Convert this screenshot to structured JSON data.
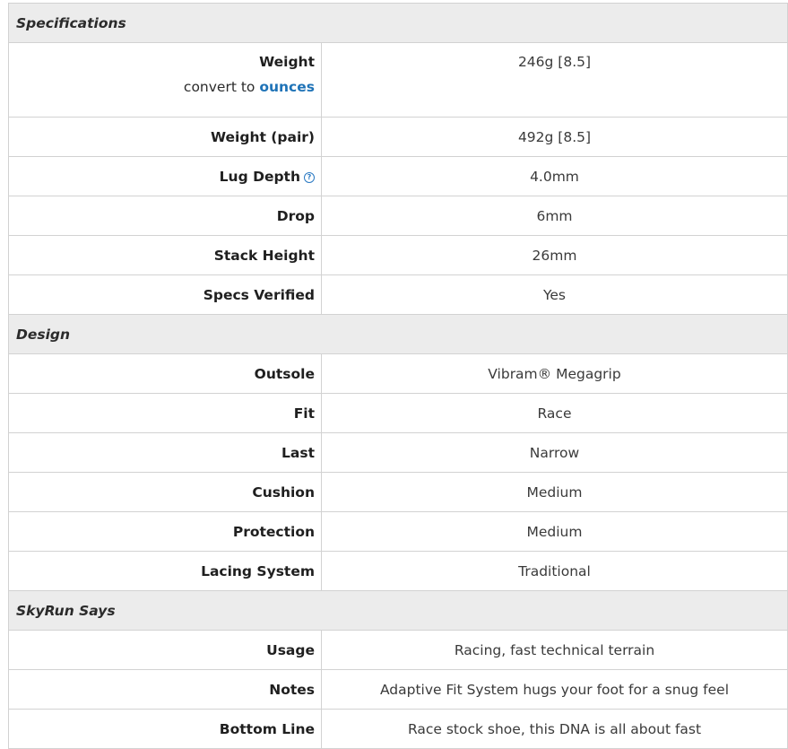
{
  "sections": [
    {
      "title": "Specifications",
      "rows": [
        {
          "label": "Weight",
          "value": "246g [8.5]",
          "convert_prefix": "convert to",
          "convert_link": "ounces"
        },
        {
          "label": "Weight (pair)",
          "value": "492g [8.5]"
        },
        {
          "label": "Lug Depth",
          "value": "4.0mm",
          "help_icon": "?"
        },
        {
          "label": "Drop",
          "value": "6mm"
        },
        {
          "label": "Stack Height",
          "value": "26mm"
        },
        {
          "label": "Specs Verified",
          "value": "Yes"
        }
      ]
    },
    {
      "title": "Design",
      "rows": [
        {
          "label": "Outsole",
          "value": "Vibram® Megagrip"
        },
        {
          "label": "Fit",
          "value": "Race"
        },
        {
          "label": "Last",
          "value": "Narrow"
        },
        {
          "label": "Cushion",
          "value": "Medium"
        },
        {
          "label": "Protection",
          "value": "Medium"
        },
        {
          "label": "Lacing System",
          "value": "Traditional"
        }
      ]
    },
    {
      "title": "SkyRun Says",
      "rows": [
        {
          "label": "Usage",
          "value": "Racing, fast technical terrain"
        },
        {
          "label": "Notes",
          "value": "Adaptive Fit System hugs your foot for a snug feel"
        },
        {
          "label": "Bottom Line",
          "value": "Race stock shoe, this DNA is all about fast"
        }
      ]
    }
  ],
  "colors": {
    "section_bg": "#ececec",
    "border": "#d2d2d2",
    "link": "#1f73b7"
  }
}
